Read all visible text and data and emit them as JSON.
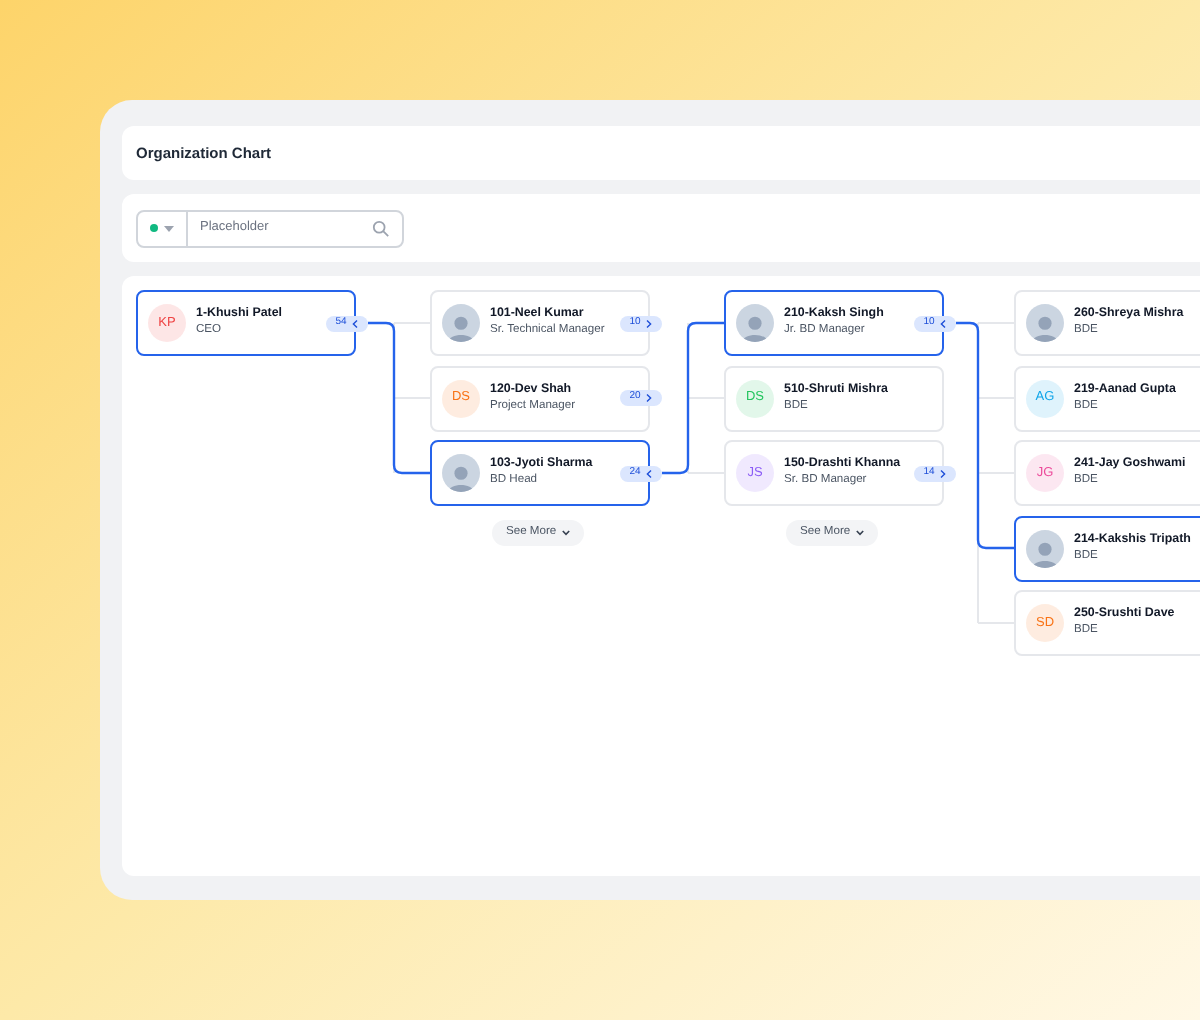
{
  "header": {
    "title": "Organization Chart"
  },
  "search": {
    "placeholder": "Placeholder"
  },
  "columns": [
    {
      "nodes": [
        {
          "name": "1-Khushi Patel",
          "role": "CEO",
          "kind": "initials",
          "initials": "KP",
          "color": "#ef4444",
          "selected": true,
          "badge": {
            "count": "54",
            "expanded": true
          }
        }
      ]
    },
    {
      "nodes": [
        {
          "name": "101-Neel Kumar",
          "role": "Sr. Technical Manager",
          "kind": "photo",
          "selected": false,
          "badge": {
            "count": "10",
            "expanded": false
          }
        },
        {
          "name": "120-Dev Shah",
          "role": "Project Manager",
          "kind": "initials",
          "initials": "DS",
          "color": "#f97316",
          "selected": false,
          "badge": {
            "count": "20",
            "expanded": false
          }
        },
        {
          "name": "103-Jyoti Sharma",
          "role": "BD Head",
          "kind": "photo",
          "selected": true,
          "badge": {
            "count": "24",
            "expanded": true
          }
        }
      ],
      "see_more": "See More"
    },
    {
      "nodes": [
        {
          "name": "210-Kaksh Singh",
          "role": "Jr. BD Manager",
          "kind": "photo",
          "selected": true,
          "badge": {
            "count": "10",
            "expanded": true
          }
        },
        {
          "name": "510-Shruti Mishra",
          "role": "BDE",
          "kind": "initials",
          "initials": "DS",
          "color": "#22c55e",
          "selected": false
        },
        {
          "name": "150-Drashti Khanna",
          "role": "Sr. BD Manager",
          "kind": "initials",
          "initials": "JS",
          "color": "#8b5cf6",
          "selected": false,
          "badge": {
            "count": "14",
            "expanded": false
          }
        }
      ],
      "see_more": "See More"
    },
    {
      "nodes": [
        {
          "name": "260-Shreya Mishra",
          "role": "BDE",
          "kind": "photo",
          "selected": false
        },
        {
          "name": "219-Aanad Gupta",
          "role": "BDE",
          "kind": "initials",
          "initials": "AG",
          "color": "#0ea5e9",
          "selected": false
        },
        {
          "name": "241-Jay Goshwami",
          "role": "BDE",
          "kind": "initials",
          "initials": "JG",
          "color": "#ec4899",
          "selected": false
        },
        {
          "name": "214-Kakshis Tripath",
          "role": "BDE",
          "kind": "photo",
          "selected": true
        },
        {
          "name": "250-Srushti Dave",
          "role": "BDE",
          "kind": "initials",
          "initials": "SD",
          "color": "#f97316",
          "selected": false
        }
      ]
    }
  ]
}
